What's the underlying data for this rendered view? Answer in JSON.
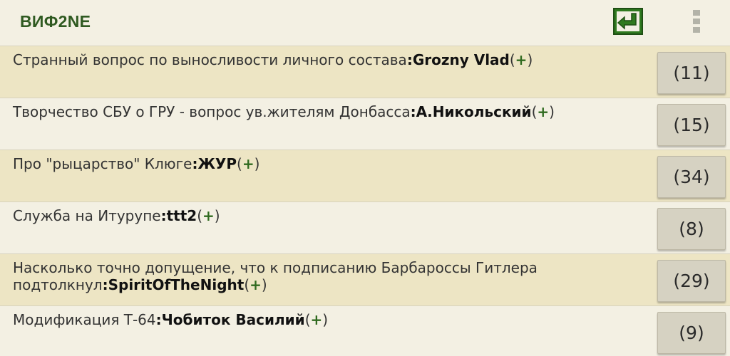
{
  "app": {
    "title": "ВИФ2NE",
    "accent_color": "#2f5a21",
    "back_icon": "back-arrow-icon",
    "menu_icon": "overflow-menu-icon"
  },
  "topics": [
    {
      "title": "Странный вопрос по выносливости личного состава",
      "separator": ":",
      "author": "Grozny Vlad",
      "open": "(",
      "plus": "+",
      "close": ")",
      "count": "(11)"
    },
    {
      "title": "Творчество СБУ о ГРУ - вопрос ув.жителям Донбасса",
      "separator": ":",
      "author": "А.Никольский",
      "open": "(",
      "plus": "+",
      "close": ")",
      "count": "(15)"
    },
    {
      "title": "Про \"рыцарство\" Клюге",
      "separator": ":",
      "author": "ЖУР",
      "open": "(",
      "plus": "+",
      "close": ")",
      "count": "(34)"
    },
    {
      "title": "Служба на Итурупе",
      "separator": ":",
      "author": "ttt2",
      "open": "(",
      "plus": "+",
      "close": ")",
      "count": "(8)"
    },
    {
      "title": "Насколько точно допущение, что к подписанию Барбароссы Гитлера подтолкнул",
      "separator": ":",
      "author": "SpiritOfTheNight",
      "open": "(",
      "plus": "+",
      "close": ")",
      "count": "(29)"
    },
    {
      "title": "Модификация Т-64",
      "separator": ":",
      "author": "Чобиток Василий",
      "open": "(",
      "plus": "+",
      "close": ")",
      "count": "(9)"
    }
  ]
}
